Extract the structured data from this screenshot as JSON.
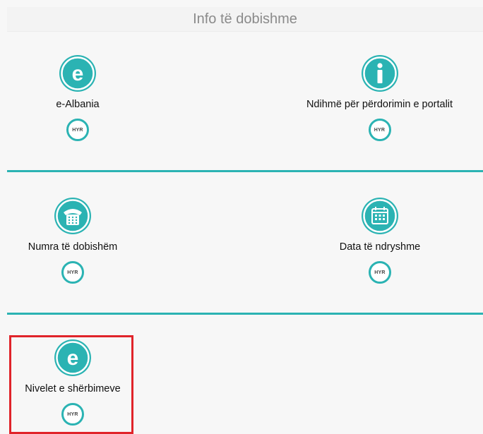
{
  "header": {
    "title": "Info të dobishme"
  },
  "cards": [
    {
      "label": "e-Albania",
      "icon": "e-letter-icon",
      "button": "HYR"
    },
    {
      "label": "Ndihmë për përdorimin e portalit",
      "icon": "info-icon",
      "button": "HYR"
    },
    {
      "label": "Numra të dobishëm",
      "icon": "phone-icon",
      "button": "HYR"
    },
    {
      "label": "Data të ndryshme",
      "icon": "calendar-icon",
      "button": "HYR"
    },
    {
      "label": "Nivelet e shërbimeve",
      "icon": "e-letter-icon",
      "button": "HYR"
    }
  ],
  "colors": {
    "accent": "#2bb3b3",
    "highlight": "#e0242a"
  }
}
